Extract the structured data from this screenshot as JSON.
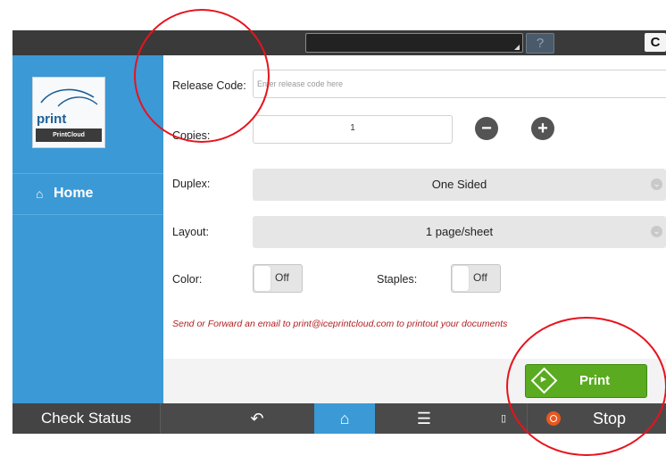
{
  "topbar": {
    "help_label": "?",
    "power_glyph": "C"
  },
  "sidebar": {
    "logo": {
      "word": "print",
      "tagline": "PrintCloud"
    },
    "items": [
      {
        "label": "Home",
        "icon": "home-icon"
      }
    ]
  },
  "form": {
    "release_code": {
      "label": "Release Code:",
      "placeholder": "Enter release code here"
    },
    "copies": {
      "label": "Copies:",
      "value": "1",
      "minus": "−",
      "plus": "+"
    },
    "duplex": {
      "label": "Duplex:",
      "value": "One Sided"
    },
    "layout": {
      "label": "Layout:",
      "value": "1 page/sheet"
    },
    "color": {
      "label": "Color:",
      "value": "Off"
    },
    "staples": {
      "label": "Staples:",
      "value": "Off"
    },
    "message": "Send or Forward an email to print@iceprintcloud.com to printout your documents",
    "print_label": "Print"
  },
  "bottombar": {
    "check_status": "Check Status",
    "stop": "Stop"
  },
  "colors": {
    "sidebar": "#3b99d6",
    "print_button": "#5aab1f",
    "annotation": "#e6141e"
  }
}
